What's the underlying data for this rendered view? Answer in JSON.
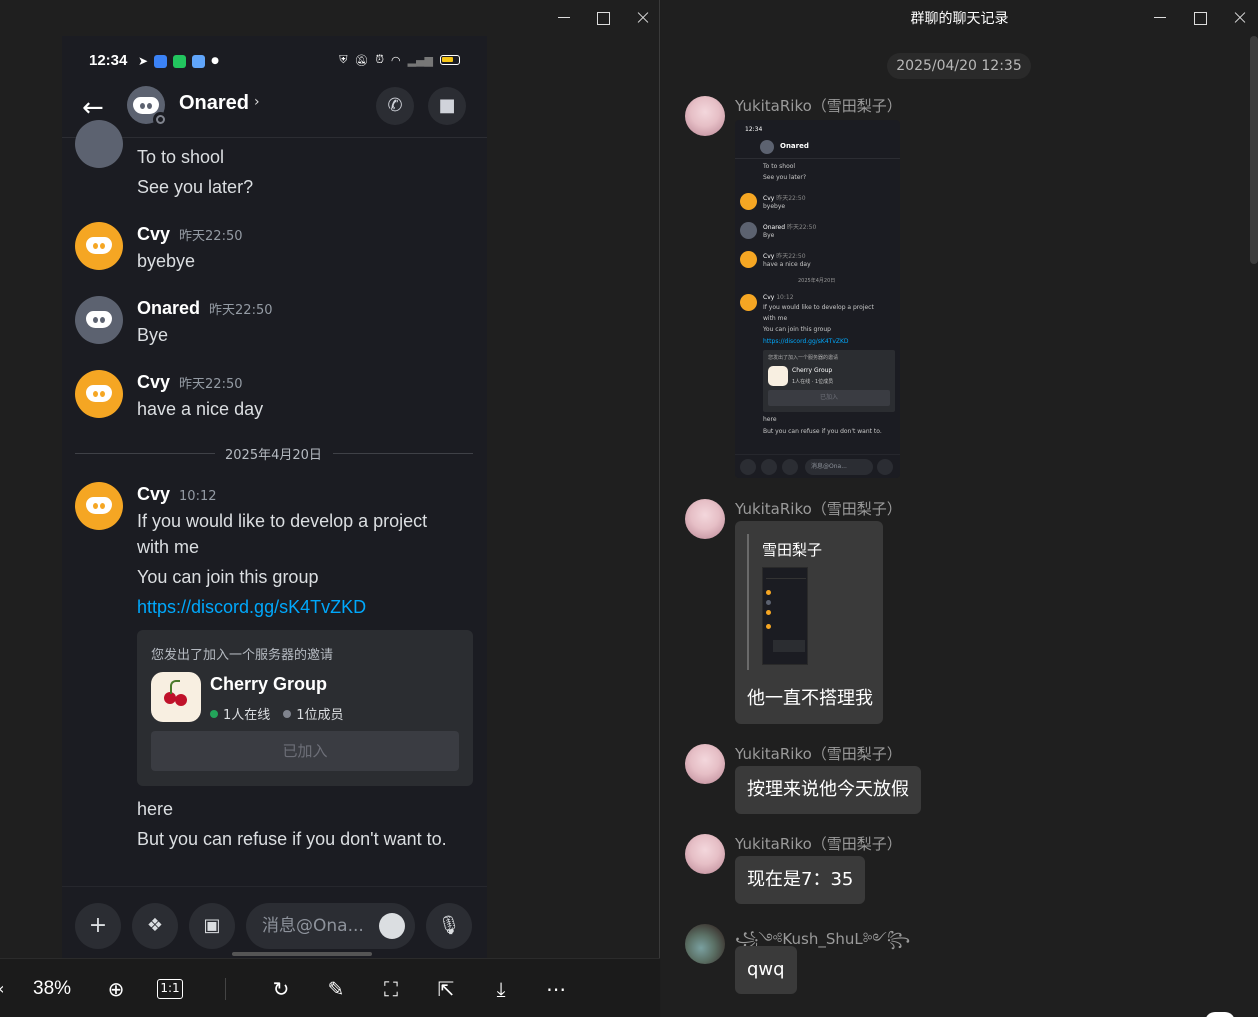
{
  "viewer": {
    "zoom": "38%",
    "toolbar": [
      "zoom-in",
      "actual-size",
      "rotate",
      "edit",
      "ocr",
      "share",
      "download",
      "more"
    ]
  },
  "phone": {
    "status_time": "12:34",
    "channel_name": "Onared",
    "messages_top": [
      "To to shool",
      "See you later?"
    ],
    "messages": [
      {
        "author": "Cvy",
        "time": "昨天22:50",
        "text": "byebye"
      },
      {
        "author": "Onared",
        "time": "昨天22:50",
        "text": "Bye"
      },
      {
        "author": "Cvy",
        "time": "昨天22:50",
        "text": "have a nice day"
      }
    ],
    "date_divider": "2025年4月20日",
    "long_msg": {
      "author": "Cvy",
      "time": "10:12",
      "line1": "If you would like to develop a project",
      "line2": "with me",
      "line3": "You can join this group",
      "link": "https://discord.gg/sK4TvZKD",
      "after1": "here",
      "after2": "But you can refuse if you don't want to."
    },
    "invite": {
      "title": "您发出了加入一个服务器的邀请",
      "server": "Cherry Group",
      "online": "1人在线",
      "members": "1位成员",
      "button": "已加入"
    },
    "input_placeholder": "消息@Ona..."
  },
  "history": {
    "title": "群聊的聊天记录",
    "date": "2025/04/20 12:35",
    "sender_riko": "YukitaRiko（雪田梨子）",
    "quote_name": "雪田梨子",
    "quote_text": "他一直不搭理我",
    "msg2": "按理来说他今天放假",
    "msg3": "现在是7：35",
    "sender_kush": "꧁༺Kush_ShuL༻꧂",
    "msg4": "qwq",
    "thumb": {
      "time": "12:34",
      "name": "Onared",
      "t1": "To to shool",
      "t2": "See you later?",
      "r1a": "Cvy",
      "r1t": "昨天22:50",
      "r1b": "byebye",
      "r2a": "Onared",
      "r2t": "昨天22:50",
      "r2b": "Bye",
      "r3a": "Cvy",
      "r3t": "昨天22:50",
      "r3b": "have a nice day",
      "date": "2025年4月20日",
      "r4a": "Cvy",
      "r4t": "10:12",
      "r4b": "If you would like to develop a project",
      "r4c": "with me",
      "r4d": "You can join this group",
      "r4e": "https://discord.gg/sK4TvZKD",
      "inv_title": "您发出了加入一个服务器的邀请",
      "inv_name": "Cherry Group",
      "inv_stats": "1人在线 · 1位成员",
      "inv_btn": "已加入",
      "after1": "here",
      "after2": "But you can refuse if you don't want to.",
      "input": "消息@Ona..."
    }
  },
  "colors": {
    "discord_orange": "#f5a623",
    "discord_gray": "#5c6270",
    "link_blue": "#00a8fc",
    "online_green": "#23a55a"
  }
}
